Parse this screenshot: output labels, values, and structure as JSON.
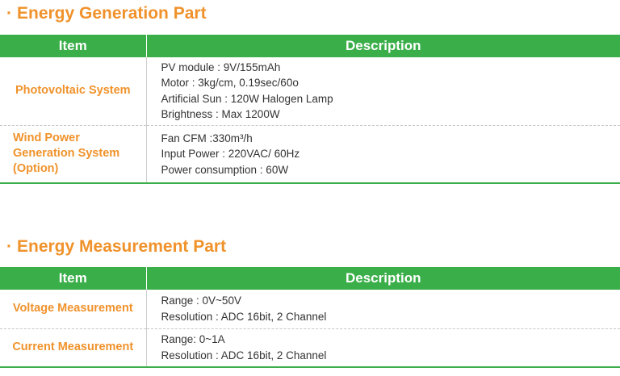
{
  "sections": [
    {
      "title": "Energy Generation Part",
      "header": {
        "item": "Item",
        "description": "Description"
      },
      "rows": [
        {
          "item": "Photovoltaic System",
          "lines": [
            "PV module : 9V/155mAh",
            "Motor : 3kg/cm, 0.19sec/60o",
            "Artificial Sun : 120W Halogen Lamp",
            "Brightness : Max 1200W"
          ]
        },
        {
          "item_lines": [
            "Wind Power",
            "Generation System",
            "(Option)"
          ],
          "lines": [
            "Fan CFM :330m³/h",
            "Input Power : 220VAC/ 60Hz",
            "Power consumption : 60W"
          ]
        }
      ]
    },
    {
      "title": "Energy Measurement Part",
      "header": {
        "item": "Item",
        "description": "Description"
      },
      "rows": [
        {
          "item": "Voltage Measurement",
          "lines": [
            "Range : 0V~50V",
            "Resolution : ADC 16bit, 2 Channel"
          ]
        },
        {
          "item": "Current Measurement",
          "lines": [
            "Range: 0~1A",
            "Resolution : ADC 16bit, 2 Channel"
          ]
        }
      ]
    }
  ],
  "colors": {
    "accent": "#f0922b",
    "header_bg": "#3aae49",
    "text": "#333333"
  }
}
